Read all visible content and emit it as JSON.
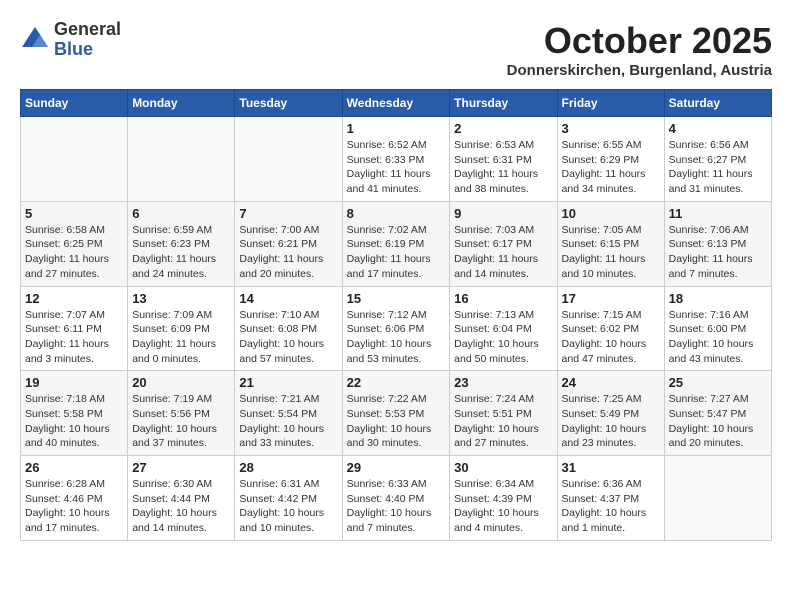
{
  "logo": {
    "general": "General",
    "blue": "Blue"
  },
  "title": "October 2025",
  "location": "Donnerskirchen, Burgenland, Austria",
  "days_of_week": [
    "Sunday",
    "Monday",
    "Tuesday",
    "Wednesday",
    "Thursday",
    "Friday",
    "Saturday"
  ],
  "weeks": [
    [
      {
        "day": "",
        "info": ""
      },
      {
        "day": "",
        "info": ""
      },
      {
        "day": "",
        "info": ""
      },
      {
        "day": "1",
        "info": "Sunrise: 6:52 AM\nSunset: 6:33 PM\nDaylight: 11 hours\nand 41 minutes."
      },
      {
        "day": "2",
        "info": "Sunrise: 6:53 AM\nSunset: 6:31 PM\nDaylight: 11 hours\nand 38 minutes."
      },
      {
        "day": "3",
        "info": "Sunrise: 6:55 AM\nSunset: 6:29 PM\nDaylight: 11 hours\nand 34 minutes."
      },
      {
        "day": "4",
        "info": "Sunrise: 6:56 AM\nSunset: 6:27 PM\nDaylight: 11 hours\nand 31 minutes."
      }
    ],
    [
      {
        "day": "5",
        "info": "Sunrise: 6:58 AM\nSunset: 6:25 PM\nDaylight: 11 hours\nand 27 minutes."
      },
      {
        "day": "6",
        "info": "Sunrise: 6:59 AM\nSunset: 6:23 PM\nDaylight: 11 hours\nand 24 minutes."
      },
      {
        "day": "7",
        "info": "Sunrise: 7:00 AM\nSunset: 6:21 PM\nDaylight: 11 hours\nand 20 minutes."
      },
      {
        "day": "8",
        "info": "Sunrise: 7:02 AM\nSunset: 6:19 PM\nDaylight: 11 hours\nand 17 minutes."
      },
      {
        "day": "9",
        "info": "Sunrise: 7:03 AM\nSunset: 6:17 PM\nDaylight: 11 hours\nand 14 minutes."
      },
      {
        "day": "10",
        "info": "Sunrise: 7:05 AM\nSunset: 6:15 PM\nDaylight: 11 hours\nand 10 minutes."
      },
      {
        "day": "11",
        "info": "Sunrise: 7:06 AM\nSunset: 6:13 PM\nDaylight: 11 hours\nand 7 minutes."
      }
    ],
    [
      {
        "day": "12",
        "info": "Sunrise: 7:07 AM\nSunset: 6:11 PM\nDaylight: 11 hours\nand 3 minutes."
      },
      {
        "day": "13",
        "info": "Sunrise: 7:09 AM\nSunset: 6:09 PM\nDaylight: 11 hours\nand 0 minutes."
      },
      {
        "day": "14",
        "info": "Sunrise: 7:10 AM\nSunset: 6:08 PM\nDaylight: 10 hours\nand 57 minutes."
      },
      {
        "day": "15",
        "info": "Sunrise: 7:12 AM\nSunset: 6:06 PM\nDaylight: 10 hours\nand 53 minutes."
      },
      {
        "day": "16",
        "info": "Sunrise: 7:13 AM\nSunset: 6:04 PM\nDaylight: 10 hours\nand 50 minutes."
      },
      {
        "day": "17",
        "info": "Sunrise: 7:15 AM\nSunset: 6:02 PM\nDaylight: 10 hours\nand 47 minutes."
      },
      {
        "day": "18",
        "info": "Sunrise: 7:16 AM\nSunset: 6:00 PM\nDaylight: 10 hours\nand 43 minutes."
      }
    ],
    [
      {
        "day": "19",
        "info": "Sunrise: 7:18 AM\nSunset: 5:58 PM\nDaylight: 10 hours\nand 40 minutes."
      },
      {
        "day": "20",
        "info": "Sunrise: 7:19 AM\nSunset: 5:56 PM\nDaylight: 10 hours\nand 37 minutes."
      },
      {
        "day": "21",
        "info": "Sunrise: 7:21 AM\nSunset: 5:54 PM\nDaylight: 10 hours\nand 33 minutes."
      },
      {
        "day": "22",
        "info": "Sunrise: 7:22 AM\nSunset: 5:53 PM\nDaylight: 10 hours\nand 30 minutes."
      },
      {
        "day": "23",
        "info": "Sunrise: 7:24 AM\nSunset: 5:51 PM\nDaylight: 10 hours\nand 27 minutes."
      },
      {
        "day": "24",
        "info": "Sunrise: 7:25 AM\nSunset: 5:49 PM\nDaylight: 10 hours\nand 23 minutes."
      },
      {
        "day": "25",
        "info": "Sunrise: 7:27 AM\nSunset: 5:47 PM\nDaylight: 10 hours\nand 20 minutes."
      }
    ],
    [
      {
        "day": "26",
        "info": "Sunrise: 6:28 AM\nSunset: 4:46 PM\nDaylight: 10 hours\nand 17 minutes."
      },
      {
        "day": "27",
        "info": "Sunrise: 6:30 AM\nSunset: 4:44 PM\nDaylight: 10 hours\nand 14 minutes."
      },
      {
        "day": "28",
        "info": "Sunrise: 6:31 AM\nSunset: 4:42 PM\nDaylight: 10 hours\nand 10 minutes."
      },
      {
        "day": "29",
        "info": "Sunrise: 6:33 AM\nSunset: 4:40 PM\nDaylight: 10 hours\nand 7 minutes."
      },
      {
        "day": "30",
        "info": "Sunrise: 6:34 AM\nSunset: 4:39 PM\nDaylight: 10 hours\nand 4 minutes."
      },
      {
        "day": "31",
        "info": "Sunrise: 6:36 AM\nSunset: 4:37 PM\nDaylight: 10 hours\nand 1 minute."
      },
      {
        "day": "",
        "info": ""
      }
    ]
  ]
}
